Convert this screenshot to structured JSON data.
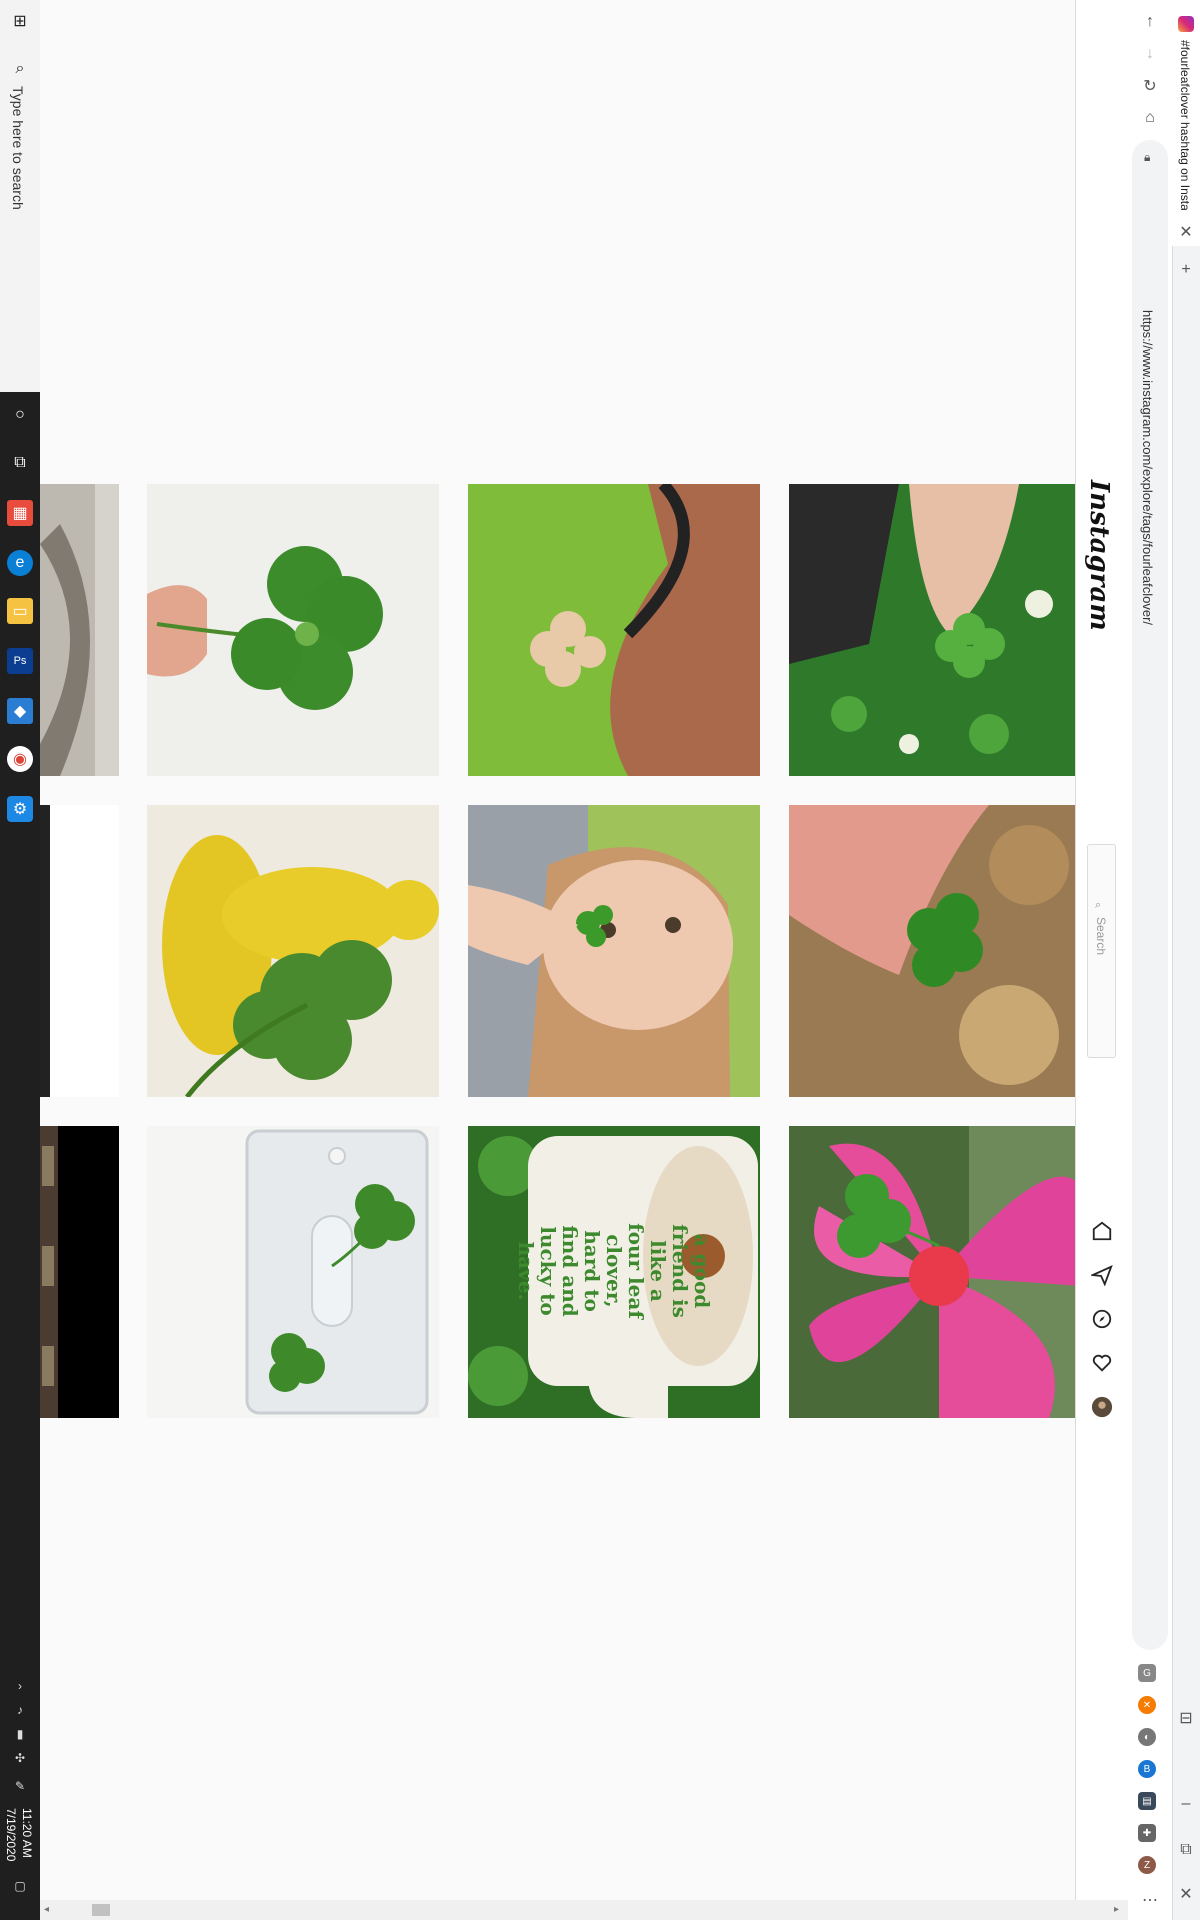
{
  "taskbar": {
    "search_placeholder": "Type here to search",
    "clock_time": "11:20 AM",
    "clock_date": "7/19/2020"
  },
  "browser": {
    "tab_title": "#fourleafclover hashtag on Insta",
    "url": "https://www.instagram.com/explore/tags/fourleafclover/"
  },
  "instagram": {
    "logo": "Instagram",
    "search_placeholder": "Search"
  },
  "grid": {
    "mug_text": "a good friend is like a four leaf clover, hard to find and lucky to have."
  },
  "colors": {
    "clover_green": "#3c8a2e",
    "flower_pink": "#e54c9a",
    "statue_yellow": "#e8cd2a",
    "taskbar": "#1f1f1f"
  }
}
